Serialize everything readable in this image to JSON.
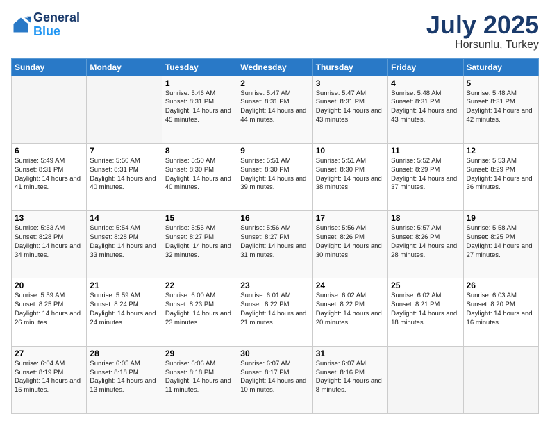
{
  "header": {
    "logo_line1": "General",
    "logo_line2": "Blue",
    "title": "July 2025",
    "subtitle": "Horsunlu, Turkey"
  },
  "days_of_week": [
    "Sunday",
    "Monday",
    "Tuesday",
    "Wednesday",
    "Thursday",
    "Friday",
    "Saturday"
  ],
  "weeks": [
    [
      {
        "day": "",
        "sunrise": "",
        "sunset": "",
        "daylight": ""
      },
      {
        "day": "",
        "sunrise": "",
        "sunset": "",
        "daylight": ""
      },
      {
        "day": "1",
        "sunrise": "Sunrise: 5:46 AM",
        "sunset": "Sunset: 8:31 PM",
        "daylight": "Daylight: 14 hours and 45 minutes."
      },
      {
        "day": "2",
        "sunrise": "Sunrise: 5:47 AM",
        "sunset": "Sunset: 8:31 PM",
        "daylight": "Daylight: 14 hours and 44 minutes."
      },
      {
        "day": "3",
        "sunrise": "Sunrise: 5:47 AM",
        "sunset": "Sunset: 8:31 PM",
        "daylight": "Daylight: 14 hours and 43 minutes."
      },
      {
        "day": "4",
        "sunrise": "Sunrise: 5:48 AM",
        "sunset": "Sunset: 8:31 PM",
        "daylight": "Daylight: 14 hours and 43 minutes."
      },
      {
        "day": "5",
        "sunrise": "Sunrise: 5:48 AM",
        "sunset": "Sunset: 8:31 PM",
        "daylight": "Daylight: 14 hours and 42 minutes."
      }
    ],
    [
      {
        "day": "6",
        "sunrise": "Sunrise: 5:49 AM",
        "sunset": "Sunset: 8:31 PM",
        "daylight": "Daylight: 14 hours and 41 minutes."
      },
      {
        "day": "7",
        "sunrise": "Sunrise: 5:50 AM",
        "sunset": "Sunset: 8:31 PM",
        "daylight": "Daylight: 14 hours and 40 minutes."
      },
      {
        "day": "8",
        "sunrise": "Sunrise: 5:50 AM",
        "sunset": "Sunset: 8:30 PM",
        "daylight": "Daylight: 14 hours and 40 minutes."
      },
      {
        "day": "9",
        "sunrise": "Sunrise: 5:51 AM",
        "sunset": "Sunset: 8:30 PM",
        "daylight": "Daylight: 14 hours and 39 minutes."
      },
      {
        "day": "10",
        "sunrise": "Sunrise: 5:51 AM",
        "sunset": "Sunset: 8:30 PM",
        "daylight": "Daylight: 14 hours and 38 minutes."
      },
      {
        "day": "11",
        "sunrise": "Sunrise: 5:52 AM",
        "sunset": "Sunset: 8:29 PM",
        "daylight": "Daylight: 14 hours and 37 minutes."
      },
      {
        "day": "12",
        "sunrise": "Sunrise: 5:53 AM",
        "sunset": "Sunset: 8:29 PM",
        "daylight": "Daylight: 14 hours and 36 minutes."
      }
    ],
    [
      {
        "day": "13",
        "sunrise": "Sunrise: 5:53 AM",
        "sunset": "Sunset: 8:28 PM",
        "daylight": "Daylight: 14 hours and 34 minutes."
      },
      {
        "day": "14",
        "sunrise": "Sunrise: 5:54 AM",
        "sunset": "Sunset: 8:28 PM",
        "daylight": "Daylight: 14 hours and 33 minutes."
      },
      {
        "day": "15",
        "sunrise": "Sunrise: 5:55 AM",
        "sunset": "Sunset: 8:27 PM",
        "daylight": "Daylight: 14 hours and 32 minutes."
      },
      {
        "day": "16",
        "sunrise": "Sunrise: 5:56 AM",
        "sunset": "Sunset: 8:27 PM",
        "daylight": "Daylight: 14 hours and 31 minutes."
      },
      {
        "day": "17",
        "sunrise": "Sunrise: 5:56 AM",
        "sunset": "Sunset: 8:26 PM",
        "daylight": "Daylight: 14 hours and 30 minutes."
      },
      {
        "day": "18",
        "sunrise": "Sunrise: 5:57 AM",
        "sunset": "Sunset: 8:26 PM",
        "daylight": "Daylight: 14 hours and 28 minutes."
      },
      {
        "day": "19",
        "sunrise": "Sunrise: 5:58 AM",
        "sunset": "Sunset: 8:25 PM",
        "daylight": "Daylight: 14 hours and 27 minutes."
      }
    ],
    [
      {
        "day": "20",
        "sunrise": "Sunrise: 5:59 AM",
        "sunset": "Sunset: 8:25 PM",
        "daylight": "Daylight: 14 hours and 26 minutes."
      },
      {
        "day": "21",
        "sunrise": "Sunrise: 5:59 AM",
        "sunset": "Sunset: 8:24 PM",
        "daylight": "Daylight: 14 hours and 24 minutes."
      },
      {
        "day": "22",
        "sunrise": "Sunrise: 6:00 AM",
        "sunset": "Sunset: 8:23 PM",
        "daylight": "Daylight: 14 hours and 23 minutes."
      },
      {
        "day": "23",
        "sunrise": "Sunrise: 6:01 AM",
        "sunset": "Sunset: 8:22 PM",
        "daylight": "Daylight: 14 hours and 21 minutes."
      },
      {
        "day": "24",
        "sunrise": "Sunrise: 6:02 AM",
        "sunset": "Sunset: 8:22 PM",
        "daylight": "Daylight: 14 hours and 20 minutes."
      },
      {
        "day": "25",
        "sunrise": "Sunrise: 6:02 AM",
        "sunset": "Sunset: 8:21 PM",
        "daylight": "Daylight: 14 hours and 18 minutes."
      },
      {
        "day": "26",
        "sunrise": "Sunrise: 6:03 AM",
        "sunset": "Sunset: 8:20 PM",
        "daylight": "Daylight: 14 hours and 16 minutes."
      }
    ],
    [
      {
        "day": "27",
        "sunrise": "Sunrise: 6:04 AM",
        "sunset": "Sunset: 8:19 PM",
        "daylight": "Daylight: 14 hours and 15 minutes."
      },
      {
        "day": "28",
        "sunrise": "Sunrise: 6:05 AM",
        "sunset": "Sunset: 8:18 PM",
        "daylight": "Daylight: 14 hours and 13 minutes."
      },
      {
        "day": "29",
        "sunrise": "Sunrise: 6:06 AM",
        "sunset": "Sunset: 8:18 PM",
        "daylight": "Daylight: 14 hours and 11 minutes."
      },
      {
        "day": "30",
        "sunrise": "Sunrise: 6:07 AM",
        "sunset": "Sunset: 8:17 PM",
        "daylight": "Daylight: 14 hours and 10 minutes."
      },
      {
        "day": "31",
        "sunrise": "Sunrise: 6:07 AM",
        "sunset": "Sunset: 8:16 PM",
        "daylight": "Daylight: 14 hours and 8 minutes."
      },
      {
        "day": "",
        "sunrise": "",
        "sunset": "",
        "daylight": ""
      },
      {
        "day": "",
        "sunrise": "",
        "sunset": "",
        "daylight": ""
      }
    ]
  ]
}
